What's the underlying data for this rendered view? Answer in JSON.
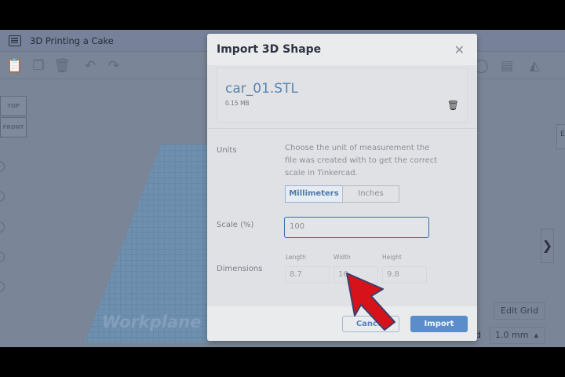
{
  "app": {
    "project_title": "3D Printing a Cake",
    "viewcube": {
      "top": "TOP",
      "front": "FRONT"
    },
    "workplane_label": "Workplane",
    "right_tab": "E",
    "edit_grid": "Edit Grid",
    "snap_label": "d",
    "snap_value": "1.0 mm"
  },
  "modal": {
    "title": "Import 3D Shape",
    "file_name": "car_01.STL",
    "file_size": "0.15 MB",
    "units_label": "Units",
    "units_description": "Choose the unit of measurement the file was created with to get the correct scale in Tinkercad.",
    "units_options": [
      "Millimeters",
      "Inches"
    ],
    "units_selected": "Millimeters",
    "scale_label": "Scale (%)",
    "scale_value": "100",
    "dimensions_label": "Dimensions",
    "dimensions": [
      {
        "label": "Length",
        "value": "8.7"
      },
      {
        "label": "Width",
        "value": "16"
      },
      {
        "label": "Height",
        "value": "9.8"
      }
    ],
    "cancel": "Cancel",
    "import": "Import"
  },
  "colors": {
    "accent": "#5c8dcb",
    "arrow": "#d6121a"
  }
}
